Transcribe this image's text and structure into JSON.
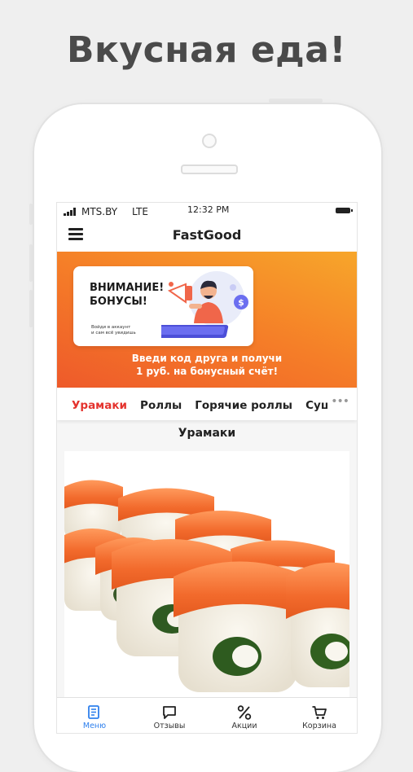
{
  "headline": "Вкусная еда!",
  "status_bar": {
    "carrier": "MTS.BY",
    "network": "LTE",
    "time": "12:32 PM"
  },
  "app": {
    "title": "FastGood"
  },
  "banner": {
    "card_title": "ВНИМАНИЕ!\nБОНУСЫ!",
    "card_subtitle": "Войди в аккаунт\nи сам всё увидишь",
    "text": "Введи код друга и получи\n1 руб. на бонусный счёт!"
  },
  "categories": {
    "items": [
      "Урамаки",
      "Роллы",
      "Горячие роллы",
      "Суши"
    ],
    "active": "Урамаки",
    "more": "•••"
  },
  "section": {
    "title": "Урамаки"
  },
  "tabs": [
    {
      "label": "Меню",
      "icon": "menu-document-icon",
      "active": true
    },
    {
      "label": "Отзывы",
      "icon": "chat-bubble-icon",
      "active": false
    },
    {
      "label": "Акции",
      "icon": "percent-icon",
      "active": false
    },
    {
      "label": "Корзина",
      "icon": "cart-icon",
      "active": false
    }
  ],
  "colors": {
    "accent_red": "#e4332e",
    "tab_active": "#2f80ed",
    "banner_orange": "#f57d28"
  }
}
